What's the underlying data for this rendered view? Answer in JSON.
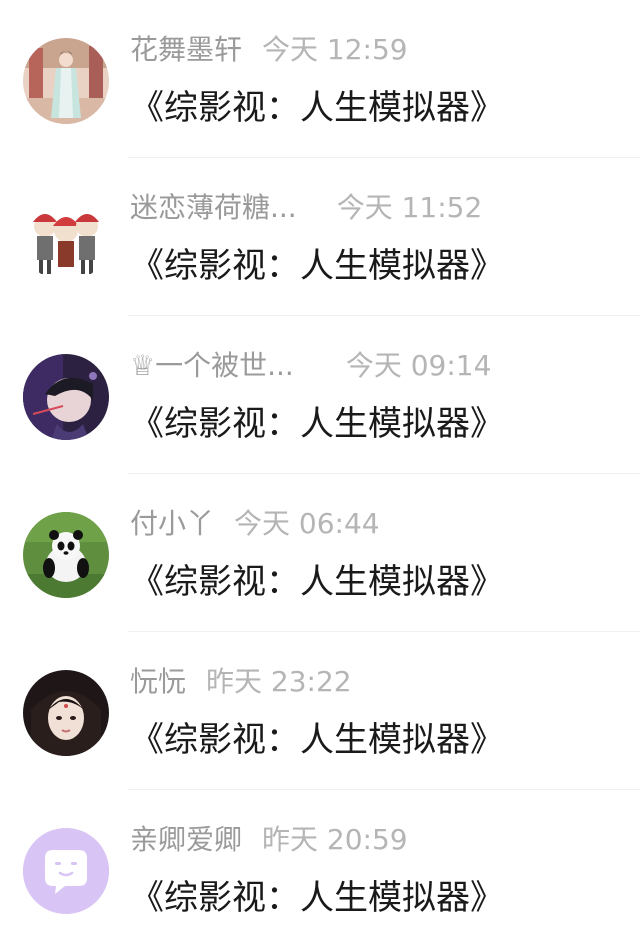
{
  "conversations": [
    {
      "name": "花舞墨轩",
      "time": "今天 12:59",
      "message": "《综影视：人生模拟器》",
      "avatar_icon": "avatar-hanfu-figure"
    },
    {
      "name": "迷恋薄荷糖...",
      "time": "今天 11:52",
      "message": "《综影视：人生模拟器》",
      "avatar_icon": "avatar-cartoon-group"
    },
    {
      "name": "♕一个被世...",
      "time": "今天 09:14",
      "message": "《综影视：人生模拟器》",
      "avatar_icon": "avatar-portrait-purple"
    },
    {
      "name": "付小丫",
      "time": "今天 06:44",
      "message": "《综影视：人生模拟器》",
      "avatar_icon": "avatar-panda"
    },
    {
      "name": "忨忨",
      "time": "昨天 23:22",
      "message": "《综影视：人生模拟器》",
      "avatar_icon": "avatar-portrait-dark"
    },
    {
      "name": "亲卿爱卿",
      "time": "昨天 20:59",
      "message": "《综影视：人生模拟器》",
      "avatar_icon": "avatar-default-chat"
    }
  ],
  "colors": {
    "name": "#9a9a9a",
    "time": "#b5b5b5",
    "message": "#1a1a1a",
    "divider": "#f0f0f0",
    "default_avatar": "#d8c4f5"
  }
}
